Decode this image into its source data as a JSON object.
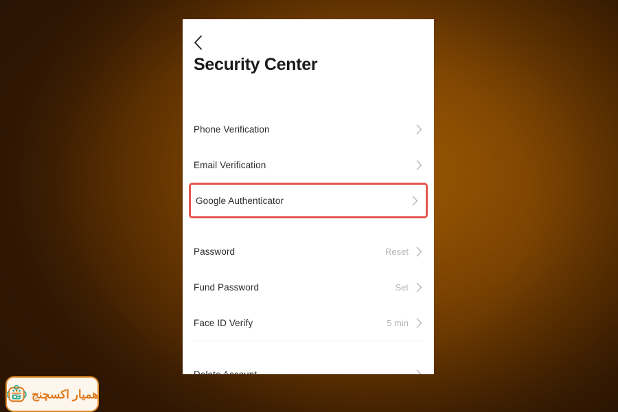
{
  "background": {
    "base_color": "#703b02",
    "glow_center_color": "#9a5703",
    "edge_color": "#331904"
  },
  "screen": {
    "back_icon": "back-chevron-icon",
    "title": "Security Center"
  },
  "groups": [
    {
      "id": "verification-group",
      "rows": [
        {
          "id": "phone-verification",
          "label": "Phone Verification",
          "value": "",
          "chevron_icon": "chevron-right-icon",
          "highlighted": false
        },
        {
          "id": "email-verification",
          "label": "Email Verification",
          "value": "",
          "chevron_icon": "chevron-right-icon",
          "highlighted": false
        },
        {
          "id": "google-authenticator",
          "label": "Google Authenticator",
          "value": "",
          "chevron_icon": "chevron-right-icon",
          "highlighted": true
        }
      ]
    },
    {
      "id": "password-group",
      "rows": [
        {
          "id": "password",
          "label": "Password",
          "value": "Reset",
          "chevron_icon": "chevron-right-icon",
          "highlighted": false
        },
        {
          "id": "fund-password",
          "label": "Fund Password",
          "value": "Set",
          "chevron_icon": "chevron-right-icon",
          "highlighted": false
        },
        {
          "id": "face-id-verify",
          "label": "Face ID Verify",
          "value": "5 min",
          "chevron_icon": "chevron-right-icon",
          "highlighted": false
        }
      ]
    },
    {
      "id": "account-group",
      "rows": [
        {
          "id": "delete-account",
          "label": "Delete Account",
          "value": "",
          "chevron_icon": "chevron-right-icon",
          "highlighted": false
        }
      ]
    }
  ],
  "highlight": {
    "color": "#e4564f",
    "target_row": "google-authenticator"
  },
  "watermark": {
    "text": "همیار اکسچنج",
    "logo_icon": "hamyar-exchange-logo-icon",
    "border_color": "#e08a2a",
    "text_color": "#e07a1f",
    "background_color": "#fdf6ec"
  }
}
